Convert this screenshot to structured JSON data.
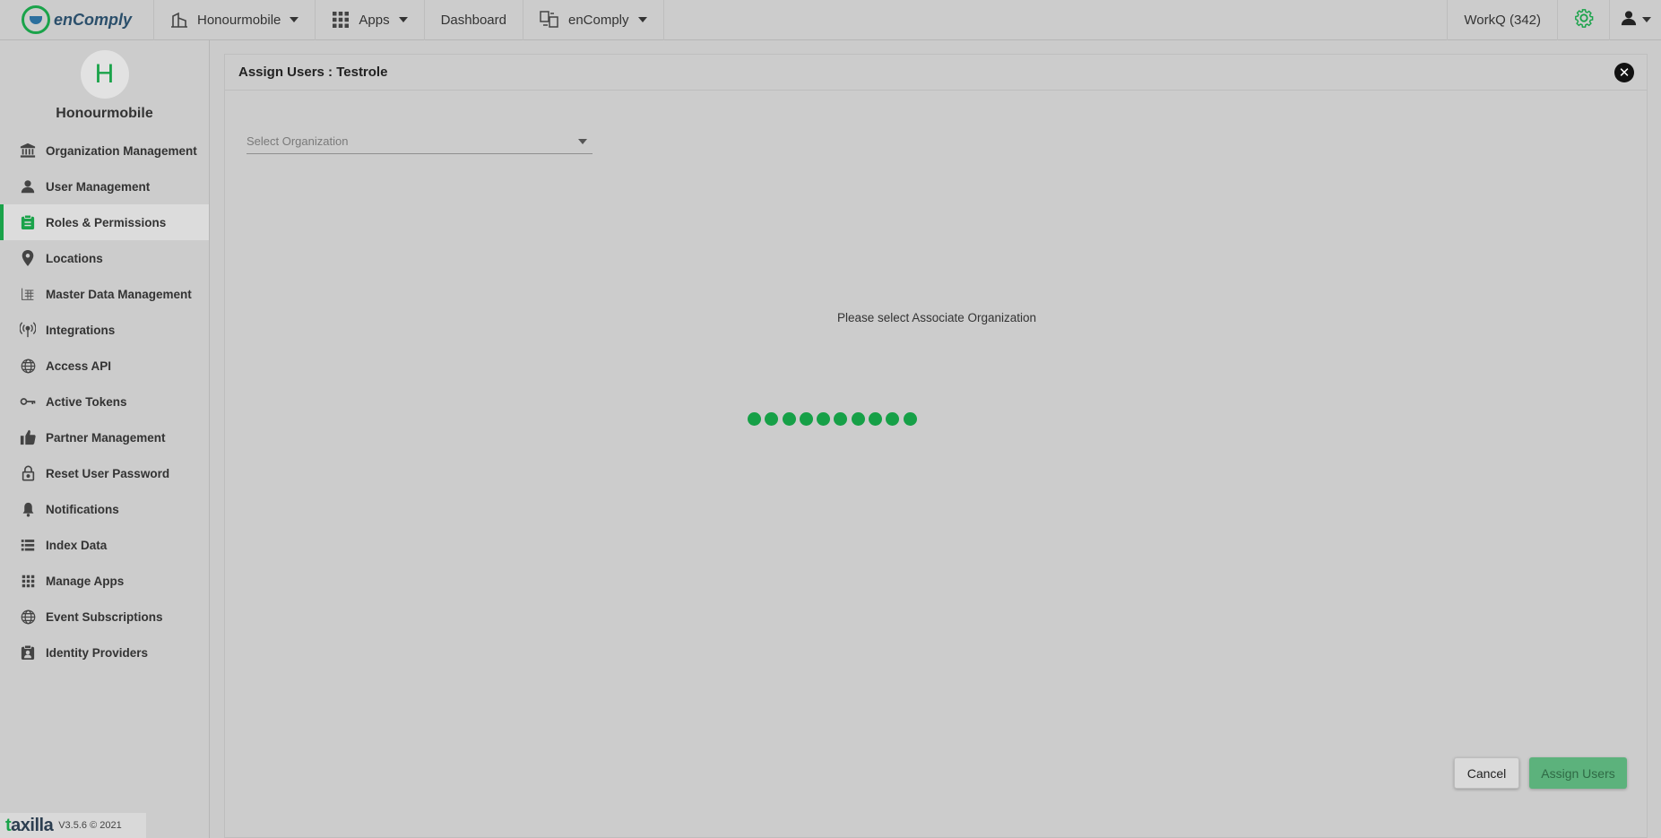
{
  "topbar": {
    "brand": "enComply",
    "org_switcher": "Honourmobile",
    "apps": "Apps",
    "dashboard": "Dashboard",
    "app_switcher": "enComply",
    "workq": "WorkQ (342)"
  },
  "sidebar": {
    "avatar_letter": "H",
    "org_name": "Honourmobile",
    "items": [
      {
        "label": "Organization Management",
        "icon": "bank-icon"
      },
      {
        "label": "User Management",
        "icon": "person-icon"
      },
      {
        "label": "Roles & Permissions",
        "icon": "clipboard-icon",
        "active": true
      },
      {
        "label": "Locations",
        "icon": "map-pin-icon"
      },
      {
        "label": "Master Data Management",
        "icon": "grid-list-icon"
      },
      {
        "label": "Integrations",
        "icon": "broadcast-icon"
      },
      {
        "label": "Access API",
        "icon": "globe-icon"
      },
      {
        "label": "Active Tokens",
        "icon": "key-icon"
      },
      {
        "label": "Partner Management",
        "icon": "thumbs-up-icon"
      },
      {
        "label": "Reset User Password",
        "icon": "lock-icon"
      },
      {
        "label": "Notifications",
        "icon": "bell-icon"
      },
      {
        "label": "Index Data",
        "icon": "list-icon"
      },
      {
        "label": "Manage Apps",
        "icon": "apps-grid-icon"
      },
      {
        "label": "Event Subscriptions",
        "icon": "globe-icon"
      },
      {
        "label": "Identity Providers",
        "icon": "id-badge-icon"
      }
    ],
    "footer": {
      "logo": "taxilla",
      "version": "V3.5.6 © 2021"
    }
  },
  "dialog": {
    "title": "Assign Users : Testrole",
    "select_placeholder": "Select Organization",
    "hint": "Please select Associate Organization",
    "loader_dots": 10,
    "cancel_label": "Cancel",
    "assign_label": "Assign Users"
  },
  "colors": {
    "accent": "#1aa34a",
    "overlay_bg": "#cccccc",
    "assign_button": "#5cb27c"
  }
}
